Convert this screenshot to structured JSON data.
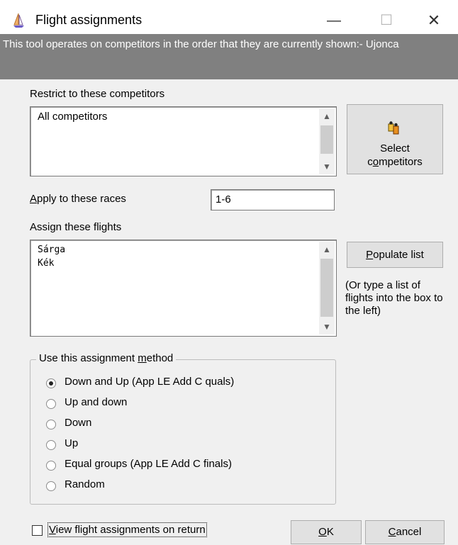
{
  "window": {
    "title": "Flight assignments",
    "controls": {
      "minimize": "—",
      "maximize": "☐",
      "close": "✕"
    }
  },
  "banner": {
    "text": "This tool operates on competitors in the order that they are currently shown:- Ujonca"
  },
  "competitors": {
    "label": "Restrict to these competitors",
    "items": [
      "All competitors"
    ],
    "select_button_line1": "Select",
    "select_button_line2_pre": "c",
    "select_button_line2_u": "o",
    "select_button_line2_post": "mpetitors"
  },
  "races": {
    "label_u": "A",
    "label_rest": "pply to these races",
    "value": "1-6"
  },
  "flights": {
    "label_pre": "Assign these fli",
    "label_u": "g",
    "label_post": "hts",
    "items": [
      "Sárga",
      "Kék"
    ],
    "populate_u": "P",
    "populate_rest": "opulate list",
    "hint": "(Or type a list of flights into the box to the left)"
  },
  "method": {
    "title_pre": "Use this assignment ",
    "title_u": "m",
    "title_post": "ethod",
    "options": [
      "Down and Up (App LE Add C quals)",
      "Up and down",
      "Down",
      "Up",
      "Equal groups (App LE Add C finals)",
      "Random"
    ],
    "selected": "Down and Up (App LE Add C quals)"
  },
  "footer": {
    "view_checkbox_u": "V",
    "view_checkbox_rest": "iew flight assignments on return",
    "view_checked": false,
    "ok_u": "O",
    "ok_rest": "K",
    "cancel_u": "C",
    "cancel_rest": "ancel"
  },
  "icons": {
    "app": "sailboat-icon",
    "competitors": "people-icon"
  },
  "colors": {
    "banner_bg": "#808080",
    "dialog_bg": "#f0f0f0"
  }
}
